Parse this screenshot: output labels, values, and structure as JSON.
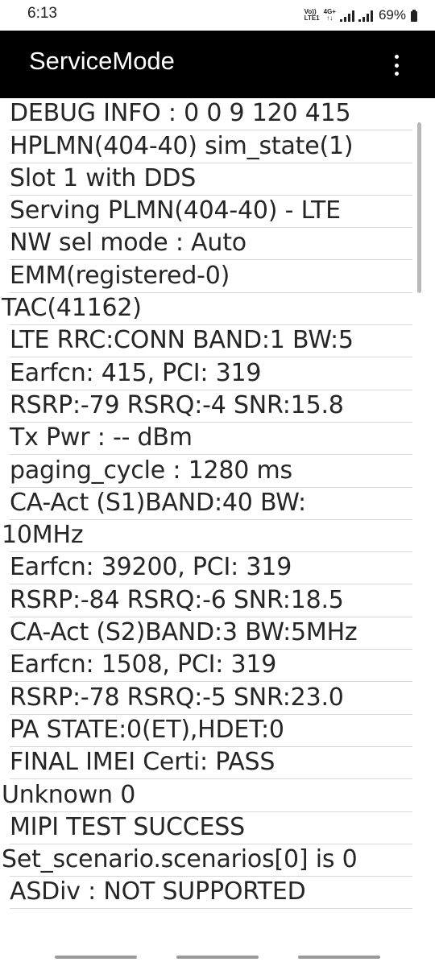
{
  "status_bar": {
    "time": "6:13",
    "volte_top": "Vo))",
    "volte_bottom": "LTE1",
    "net_top": "4G+",
    "net_bottom": "↑↓",
    "battery": "69%"
  },
  "app_bar": {
    "title": "ServiceMode",
    "menu_icon": "overflow-menu-icon"
  },
  "info_lines": [
    " DEBUG INFO : 0 0 9 120 415",
    " HPLMN(404-40) sim_state(1)",
    " Slot 1 with DDS",
    " Serving PLMN(404-40) - LTE",
    " NW sel mode : Auto",
    " EMM(registered-0)",
    "TAC(41162)",
    " LTE RRC:CONN BAND:1 BW:5",
    " Earfcn: 415, PCI: 319",
    " RSRP:-79 RSRQ:-4 SNR:15.8",
    " Tx Pwr : -- dBm",
    " paging_cycle : 1280 ms",
    " CA-Act (S1)BAND:40 BW:",
    "10MHz",
    " Earfcn: 39200, PCI: 319",
    " RSRP:-84 RSRQ:-6 SNR:18.5",
    " CA-Act (S2)BAND:3 BW:5MHz",
    " Earfcn: 1508, PCI: 319",
    " RSRP:-78 RSRQ:-5 SNR:23.0",
    " PA STATE:0(ET),HDET:0",
    " FINAL IMEI Certi: PASS",
    "Unknown 0",
    " MIPI TEST SUCCESS",
    "Set_scenario.scenarios[0] is 0",
    " ASDiv : NOT SUPPORTED",
    ""
  ],
  "colors": {
    "app_bar_bg": "#000000",
    "content_bg": "#ffffff",
    "text": "#262626",
    "divider": "#d8d8d8"
  }
}
